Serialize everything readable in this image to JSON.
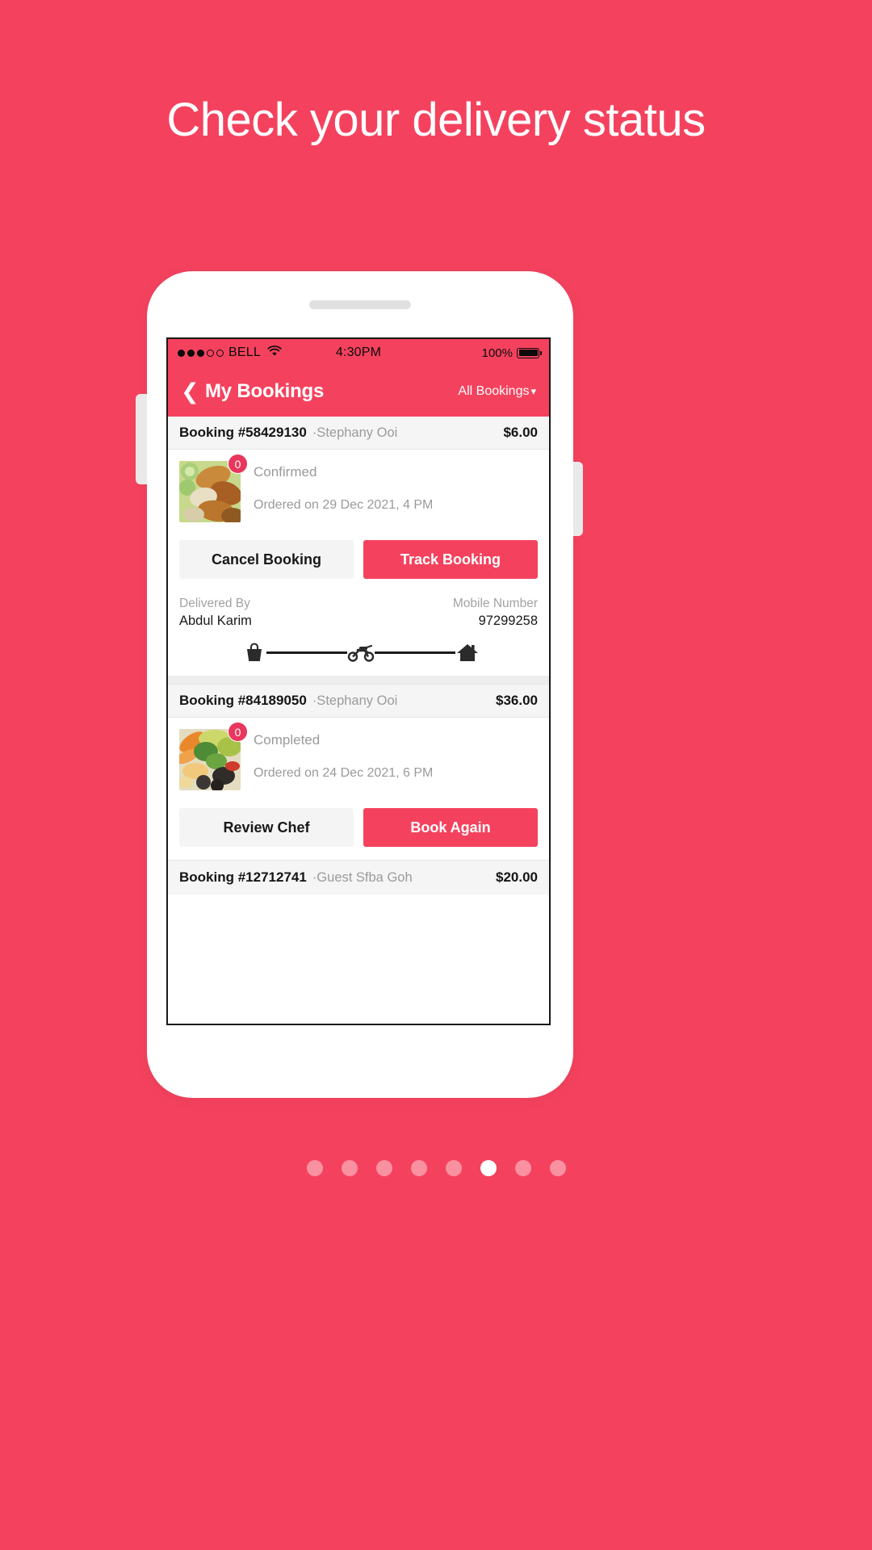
{
  "promo": {
    "headline": "Check your delivery status",
    "background_color": "#F4425E",
    "accent_color": "#F4425E"
  },
  "status_bar": {
    "carrier": "BELL",
    "signal_filled": 3,
    "signal_hollow": 2,
    "wifi_icon": "wifi-icon",
    "time": "4:30PM",
    "battery_percent": "100%"
  },
  "nav": {
    "back_icon": "chevron-left-icon",
    "title": "My Bookings",
    "filter_label": "All Bookings",
    "filter_chevron": "chevron-down-icon"
  },
  "bookings": [
    {
      "id": "Booking #58429130",
      "customer": "·Stephany Ooi",
      "amount": "$6.00",
      "badge": "0",
      "status": "Confirmed",
      "ordered": "Ordered on 29 Dec 2021, 4 PM",
      "primary_button": "Track Booking",
      "secondary_button": "Cancel Booking",
      "delivered_by_label": "Delivered By",
      "delivered_by_value": "Abdul Karim",
      "mobile_label": "Mobile Number",
      "mobile_value": "97299258",
      "track_icons": [
        "shopping-bag-icon",
        "motorbike-icon",
        "home-icon"
      ]
    },
    {
      "id": "Booking #84189050",
      "customer": "·Stephany Ooi",
      "amount": "$36.00",
      "badge": "0",
      "status": "Completed",
      "ordered": "Ordered on 24 Dec 2021, 6 PM",
      "primary_button": "Book Again",
      "secondary_button": "Review Chef"
    }
  ],
  "bottom_booking": {
    "id": "Booking #12712741",
    "customer": "·Guest Sfba Goh",
    "amount": "$20.00"
  },
  "pagination": {
    "total": 8,
    "active_index": 5
  }
}
